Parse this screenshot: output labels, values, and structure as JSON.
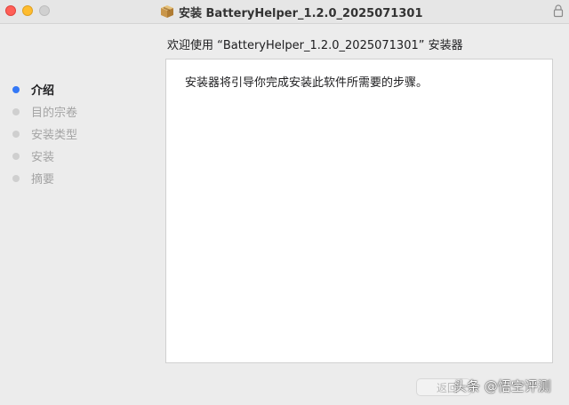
{
  "window": {
    "title": "安装 BatteryHelper_1.2.0_2025071301"
  },
  "heading": "欢迎使用 “BatteryHelper_1.2.0_2025071301” 安装器",
  "steps": [
    {
      "label": "介绍",
      "active": true
    },
    {
      "label": "目的宗卷",
      "active": false
    },
    {
      "label": "安装类型",
      "active": false
    },
    {
      "label": "安装",
      "active": false
    },
    {
      "label": "摘要",
      "active": false
    }
  ],
  "panel": {
    "text": "安装器将引导你完成安装此软件所需要的步骤。"
  },
  "buttons": {
    "back_label": "返回"
  },
  "watermark": "头条 @悟空评测",
  "colors": {
    "accent": "#3478f6",
    "close": "#ff5f57",
    "minimize": "#febc2e"
  },
  "icons": {
    "title": "package-icon",
    "lock": "lock-icon"
  }
}
